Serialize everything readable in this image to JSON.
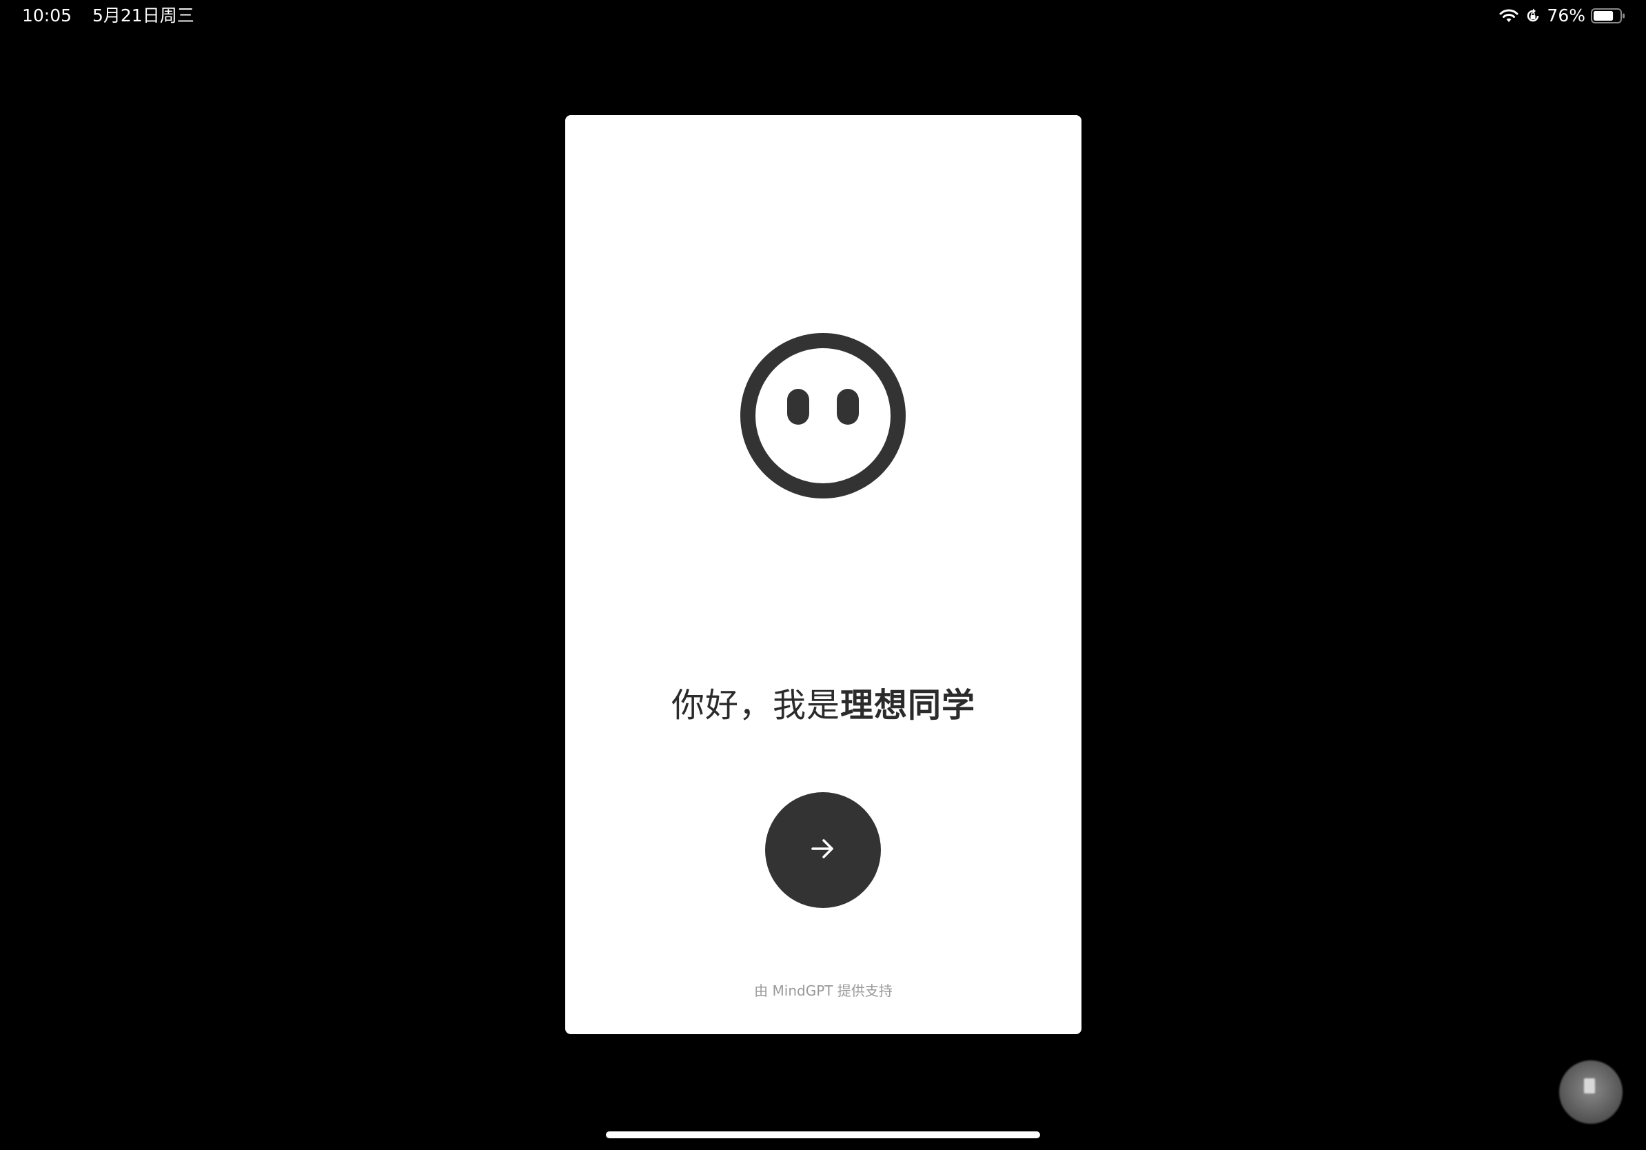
{
  "status_bar": {
    "time": "10:05",
    "date": "5月21日周三",
    "battery_percent": "76%",
    "battery_level": 0.76,
    "icons": [
      "wifi-icon",
      "orientation-lock-icon",
      "battery-icon"
    ]
  },
  "welcome": {
    "mascot_icon": "smiley-face-icon",
    "greeting_prefix": "你好，我是",
    "greeting_name": "理想同学",
    "next_icon": "arrow-right-icon",
    "powered_by": "由 MindGPT 提供支持"
  },
  "colors": {
    "background": "#000000",
    "card": "#ffffff",
    "accent_dark": "#333333",
    "text_dark": "#2b2b2b",
    "text_muted": "#9a9a9a"
  }
}
